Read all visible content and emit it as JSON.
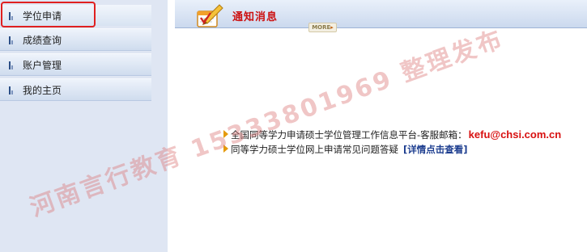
{
  "sidebar": {
    "items": [
      {
        "label": "学位申请",
        "active": true
      },
      {
        "label": "成绩查询",
        "active": false
      },
      {
        "label": "账户管理",
        "active": false
      },
      {
        "label": "我的主页",
        "active": false
      }
    ]
  },
  "header": {
    "title": "通知消息",
    "more_label": "MORE"
  },
  "notices": [
    {
      "text": "全国同等学力申请硕士学位管理工作信息平台-客服邮箱：",
      "email": "kefu@chsi.com.cn"
    },
    {
      "text": "同等学力硕士学位网上申请常见问题答疑",
      "link": "[详情点击查看]"
    }
  ],
  "watermark": "河南言行教育 15333801969 整理发布",
  "colors": {
    "sidebar_bg": "#dfe6f3",
    "title_red": "#cc1111",
    "email_red": "#d81010",
    "link_blue": "#1c3d8f",
    "highlight": "#e02020"
  }
}
